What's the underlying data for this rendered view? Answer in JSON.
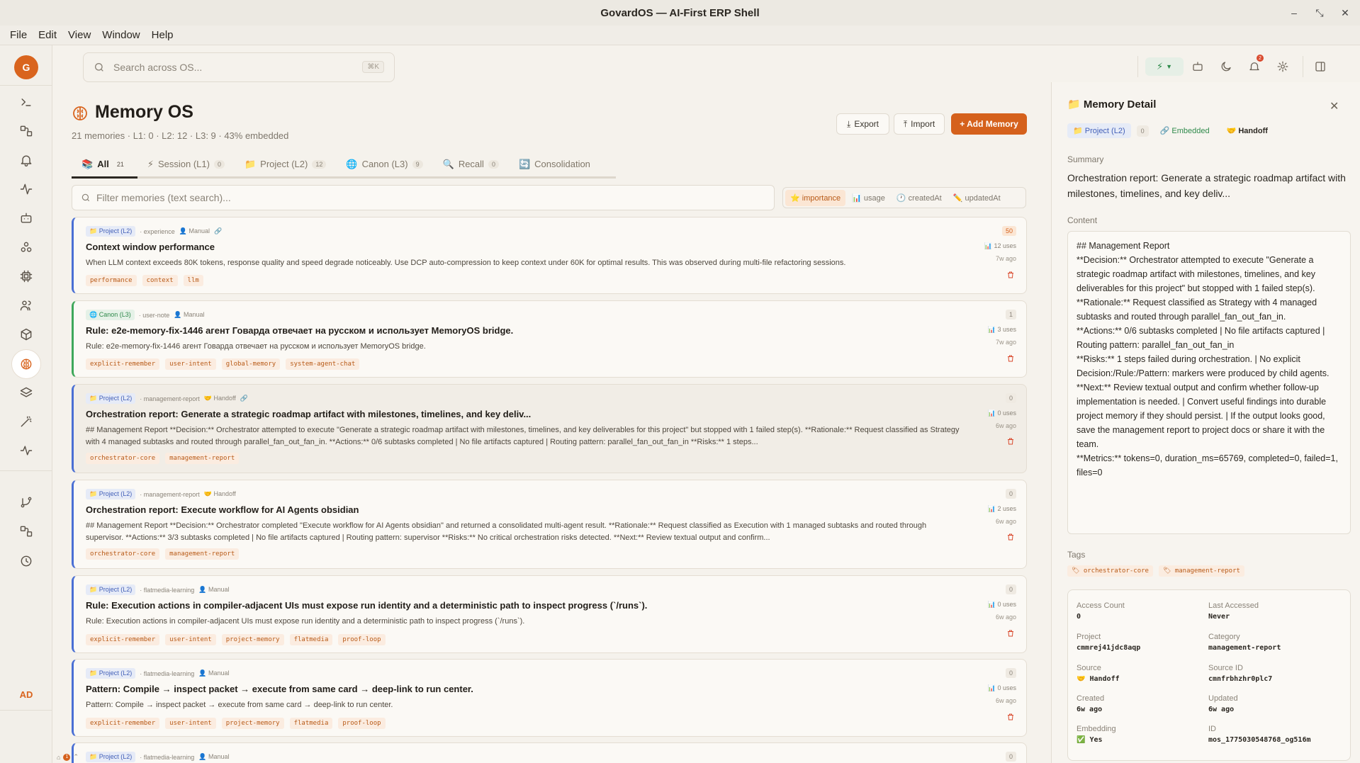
{
  "window": {
    "title": "GovardOS — AI-First ERP Shell"
  },
  "menu": [
    "File",
    "Edit",
    "View",
    "Window",
    "Help"
  ],
  "rail": {
    "logo": "G",
    "avatar": "AD"
  },
  "search": {
    "placeholder": "Search across OS...",
    "shortcut": "⌘K"
  },
  "page": {
    "title": "Memory OS",
    "stats": "21 memories · L1: 0 · L2: 12 · L3: 9 · 43% embedded",
    "export": "Export",
    "import": "Import",
    "add": "+ Add Memory"
  },
  "tabs": [
    {
      "icon": "📚",
      "label": "All",
      "count": "21"
    },
    {
      "icon": "⚡",
      "label": "Session (L1)",
      "count": "0"
    },
    {
      "icon": "📁",
      "label": "Project (L2)",
      "count": "12"
    },
    {
      "icon": "🌐",
      "label": "Canon (L3)",
      "count": "9"
    },
    {
      "icon": "🔍",
      "label": "Recall",
      "count": "0"
    },
    {
      "icon": "🔄",
      "label": "Consolidation",
      "count": ""
    }
  ],
  "filter": {
    "placeholder": "Filter memories (text search)..."
  },
  "sorts": [
    {
      "label": "⭐ importance"
    },
    {
      "label": "📊 usage"
    },
    {
      "label": "🕐 createdAt"
    },
    {
      "label": "✏️ updatedAt"
    }
  ],
  "cards": [
    {
      "level": "📁 Project (L2)",
      "category": "· experience",
      "source": "👤 Manual",
      "link": "🔗",
      "title": "Context window performance",
      "body": "When LLM context exceeds 80K tokens, response quality and speed degrade noticeably. Use DCP auto-compression to keep context under 60K for optimal results. This was observed during multi-file refactoring sessions.",
      "tags": [
        "performance",
        "context",
        "llm"
      ],
      "score": "50",
      "uses": "12 uses",
      "age": "7w ago"
    },
    {
      "level": "🌐 Canon (L3)",
      "category": "· user-note",
      "source": "👤 Manual",
      "link": "",
      "title": "Rule: e2e-memory-fix-1446 агент Говарда отвечает на русском и использует MemoryOS bridge.",
      "body": "Rule: e2e-memory-fix-1446 агент Говарда отвечает на русском и использует MemoryOS bridge.",
      "tags": [
        "explicit-remember",
        "user-intent",
        "global-memory",
        "system-agent-chat"
      ],
      "score": "1",
      "uses": "3 uses",
      "age": "7w ago"
    },
    {
      "level": "📁 Project (L2)",
      "category": "· management-report",
      "source": "🤝 Handoff",
      "link": "🔗",
      "title": "Orchestration report: Generate a strategic roadmap artifact with milestones, timelines, and key deliv...",
      "body": "## Management Report **Decision:** Orchestrator attempted to execute \"Generate a strategic roadmap artifact with milestones, timelines, and key deliverables for this project\" but stopped with 1 failed step(s). **Rationale:** Request classified as Strategy with 4 managed subtasks and routed through parallel_fan_out_fan_in. **Actions:** 0/6 subtasks completed | No file artifacts captured | Routing pattern: parallel_fan_out_fan_in **Risks:** 1 steps...",
      "tags": [
        "orchestrator-core",
        "management-report"
      ],
      "score": "0",
      "uses": "0 uses",
      "age": "6w ago"
    },
    {
      "level": "📁 Project (L2)",
      "category": "· management-report",
      "source": "🤝 Handoff",
      "link": "",
      "title": "Orchestration report: Execute workflow for AI Agents obsidian",
      "body": "## Management Report **Decision:** Orchestrator completed \"Execute workflow for AI Agents obsidian\" and returned a consolidated multi-agent result. **Rationale:** Request classified as Execution with 1 managed subtasks and routed through supervisor. **Actions:** 3/3 subtasks completed | No file artifacts captured | Routing pattern: supervisor **Risks:** No critical orchestration risks detected. **Next:** Review textual output and confirm...",
      "tags": [
        "orchestrator-core",
        "management-report"
      ],
      "score": "0",
      "uses": "2 uses",
      "age": "6w ago"
    },
    {
      "level": "📁 Project (L2)",
      "category": "· flatmedia-learning",
      "source": "👤 Manual",
      "link": "",
      "title": "Rule: Execution actions in compiler-adjacent UIs must expose run identity and a deterministic path to inspect progress (`/runs`).",
      "body": "Rule: Execution actions in compiler-adjacent UIs must expose run identity and a deterministic path to inspect progress (`/runs`).",
      "tags": [
        "explicit-remember",
        "user-intent",
        "project-memory",
        "flatmedia",
        "proof-loop"
      ],
      "score": "0",
      "uses": "0 uses",
      "age": "6w ago"
    },
    {
      "level": "📁 Project (L2)",
      "category": "· flatmedia-learning",
      "source": "👤 Manual",
      "link": "",
      "title": "Pattern: Compile → inspect packet → execute from same card → deep-link to run center.",
      "body": "Pattern: Compile → inspect packet → execute from same card → deep-link to run center.",
      "tags": [
        "explicit-remember",
        "user-intent",
        "project-memory",
        "flatmedia",
        "proof-loop"
      ],
      "score": "0",
      "uses": "0 uses",
      "age": "6w ago"
    },
    {
      "level": "📁 Project (L2)",
      "category": "· flatmedia-learning",
      "source": "👤 Manual",
      "link": "",
      "title": "",
      "body": "",
      "tags": [],
      "score": "0",
      "uses": "",
      "age": ""
    }
  ],
  "detail": {
    "title": "📁 Memory Detail",
    "chips": {
      "level": "📁 Project (L2)",
      "num": "0",
      "embedded": "🔗 Embedded",
      "source": "🤝 Handoff"
    },
    "summary_label": "Summary",
    "summary": "Orchestration report: Generate a strategic roadmap artifact with milestones, timelines, and key deliv...",
    "content_label": "Content",
    "content": [
      "## Management Report",
      "**Decision:** Orchestrator attempted to execute \"Generate a strategic roadmap artifact with milestones, timelines, and key deliverables for this project\" but stopped with 1 failed step(s).",
      "**Rationale:** Request classified as Strategy with 4 managed subtasks and routed through parallel_fan_out_fan_in.",
      "**Actions:** 0/6 subtasks completed | No file artifacts captured | Routing pattern: parallel_fan_out_fan_in",
      "**Risks:** 1 steps failed during orchestration. | No explicit Decision:/Rule:/Pattern: markers were produced by child agents.",
      "**Next:** Review textual output and confirm whether follow-up implementation is needed. | Convert useful findings into durable project memory if they should persist. | If the output looks good, save the management report to project docs or share it with the team.",
      "**Metrics:** tokens=0, duration_ms=65769, completed=0, failed=1, files=0"
    ],
    "tags_label": "Tags",
    "tags": [
      "🏷 orchestrator-core",
      "🏷 management-report"
    ],
    "info": {
      "access_count_label": "Access Count",
      "access_count": "0",
      "last_accessed_label": "Last Accessed",
      "last_accessed": "Never",
      "project_label": "Project",
      "project": "cmmrej41jdc8aqp",
      "category_label": "Category",
      "category": "management-report",
      "source_label": "Source",
      "source": "🤝 Handoff",
      "source_id_label": "Source ID",
      "source_id": "cmnfrbhzhr0plc7",
      "created_label": "Created",
      "created": "6w ago",
      "updated_label": "Updated",
      "updated": "6w ago",
      "embedding_label": "Embedding",
      "embedding": "✅ Yes",
      "id_label": "ID",
      "id": "mos_1775030548768_og516m"
    }
  }
}
